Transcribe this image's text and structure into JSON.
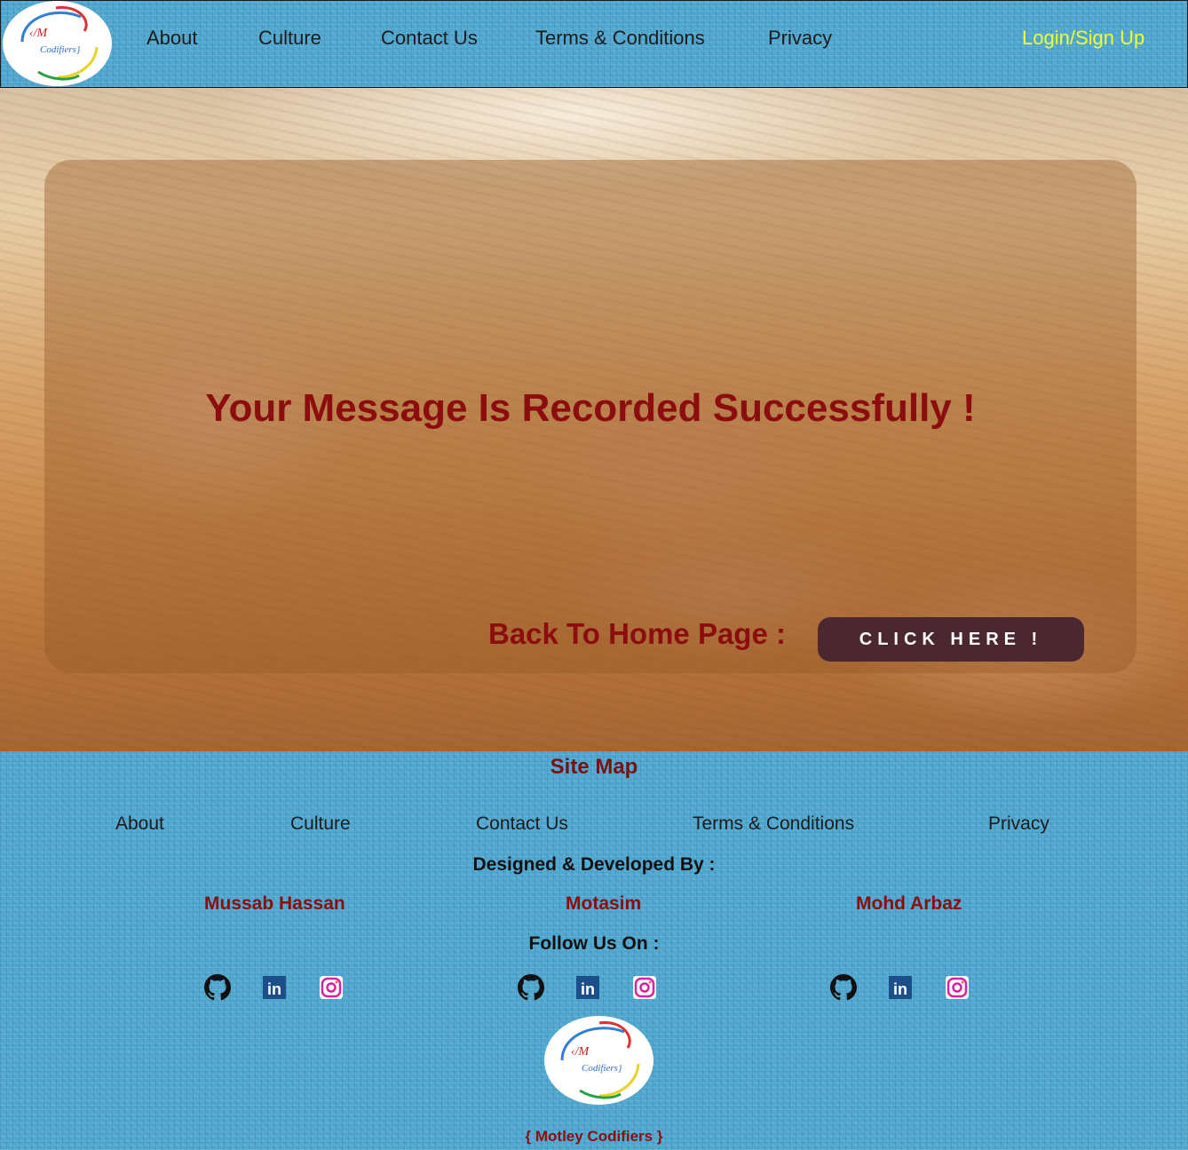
{
  "nav": {
    "links": [
      "About",
      "Culture",
      "Contact Us",
      "Terms & Conditions",
      "Privacy"
    ],
    "login": "Login/Sign Up",
    "login_color": "#f1ff2e"
  },
  "hero": {
    "message": "Your Message Is Recorded Successfully !",
    "back_label": "Back To Home Page :",
    "button_label": "CLICK HERE !"
  },
  "footer": {
    "sitemap_title": "Site Map",
    "links": [
      "About",
      "Culture",
      "Contact Us",
      "Terms & Conditions",
      "Privacy"
    ],
    "designed_by": "Designed & Developed By :",
    "developers": [
      "Mussab Hassan",
      "Motasim",
      "Mohd Arbaz"
    ],
    "follow": "Follow Us On :",
    "social_icons": [
      "github-icon",
      "linkedin-icon",
      "instagram-icon"
    ],
    "brand": "{ Motley Codifiers }"
  },
  "colors": {
    "header_bg": "#4ea6ce",
    "accent_red": "#8b0d0d",
    "button_bg": "#4b2830"
  }
}
